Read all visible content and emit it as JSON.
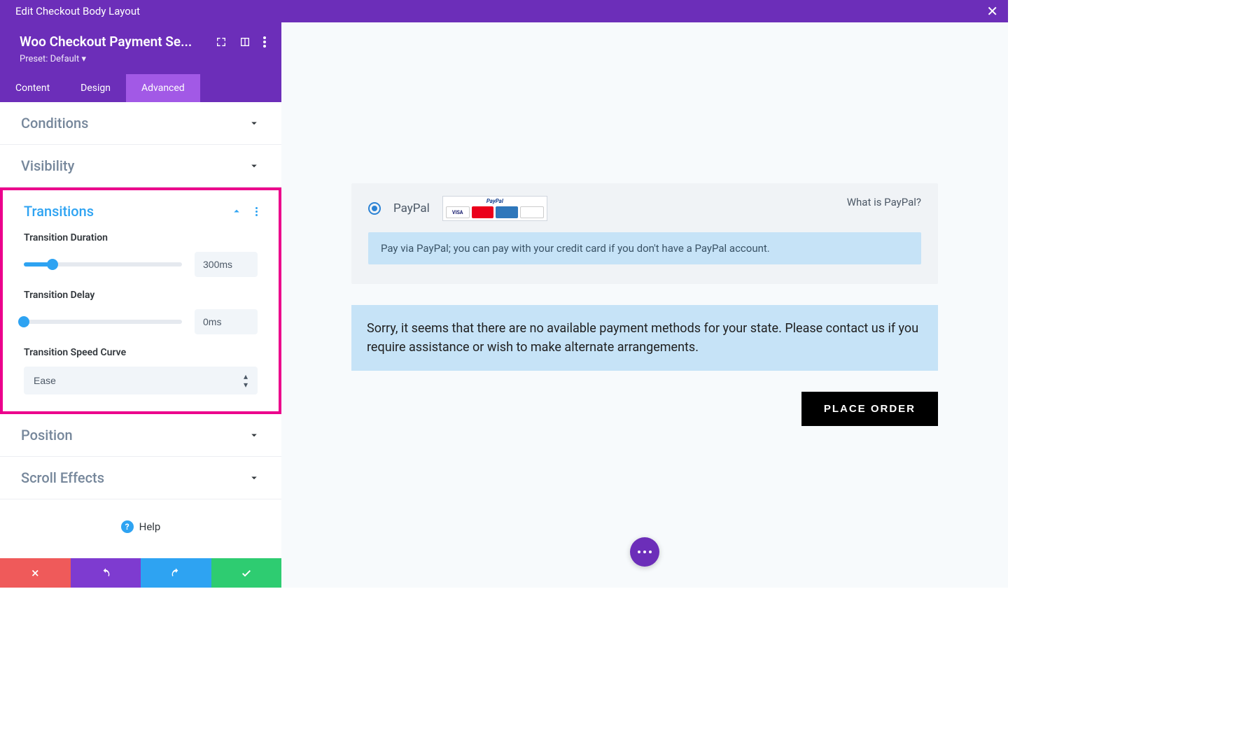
{
  "titlebar": {
    "title": "Edit Checkout Body Layout"
  },
  "module": {
    "title": "Woo Checkout Payment Se...",
    "preset_prefix": "Preset:",
    "preset_value": "Default"
  },
  "tabs": [
    {
      "id": "content",
      "label": "Content"
    },
    {
      "id": "design",
      "label": "Design"
    },
    {
      "id": "advanced",
      "label": "Advanced",
      "active": true
    }
  ],
  "sections": {
    "conditions": "Conditions",
    "visibility": "Visibility",
    "transitions": {
      "title": "Transitions",
      "fields": {
        "duration": {
          "label": "Transition Duration",
          "value": "300ms",
          "pct": 18
        },
        "delay": {
          "label": "Transition Delay",
          "value": "0ms",
          "pct": 0
        },
        "curve": {
          "label": "Transition Speed Curve",
          "value": "Ease"
        }
      }
    },
    "position": "Position",
    "scroll_effects": "Scroll Effects"
  },
  "help": "Help",
  "preview": {
    "paypal_label": "PayPal",
    "whatis": "What is PayPal?",
    "paypal_desc": "Pay via PayPal; you can pay with your credit card if you don't have a PayPal account.",
    "warning": "Sorry, it seems that there are no available payment methods for your state. Please contact us if you require assistance or wish to make alternate arrangements.",
    "place_order": "PLACE ORDER"
  }
}
